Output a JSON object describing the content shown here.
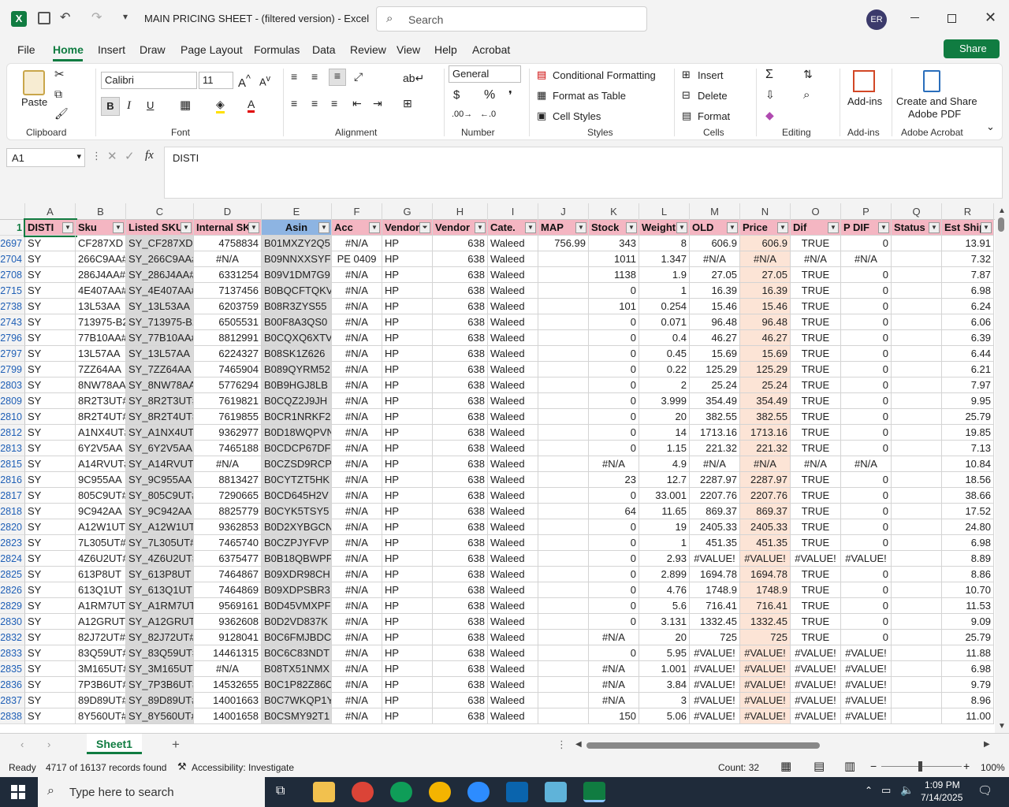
{
  "window": {
    "title": "MAIN PRICING SHEET - (filtered version)  -  Excel",
    "search_placeholder": "Search",
    "user_initials": "ER"
  },
  "menu": [
    "File",
    "Home",
    "Insert",
    "Draw",
    "Page Layout",
    "Formulas",
    "Data",
    "Review",
    "View",
    "Help",
    "Acrobat"
  ],
  "share_label": "Share",
  "ribbon": {
    "clipboard": {
      "paste": "Paste",
      "label": "Clipboard"
    },
    "font": {
      "name": "Calibri",
      "size": "11",
      "label": "Font"
    },
    "alignment": {
      "label": "Alignment"
    },
    "number": {
      "format": "General",
      "label": "Number"
    },
    "styles": {
      "cond": "Conditional Formatting",
      "table": "Format as Table",
      "cell": "Cell Styles",
      "label": "Styles"
    },
    "cells": {
      "insert": "Insert",
      "delete": "Delete",
      "format": "Format",
      "label": "Cells"
    },
    "editing": {
      "label": "Editing"
    },
    "addins": {
      "btn": "Add-ins",
      "label": "Add-ins"
    },
    "acrobat": {
      "btn1": "Create and Share",
      "btn2": "Adobe PDF",
      "label": "Adobe Acrobat"
    }
  },
  "formula": {
    "namebox": "A1",
    "content": "DISTI"
  },
  "columns": [
    "A",
    "B",
    "C",
    "D",
    "E",
    "F",
    "G",
    "H",
    "I",
    "J",
    "K",
    "L",
    "M",
    "N",
    "O",
    "P",
    "Q",
    "R"
  ],
  "headers": [
    "DISTI",
    "Sku",
    "Listed SKU",
    "Internal SK",
    "Asin",
    "Acc",
    "Vendor",
    "Vendor",
    "Cate.",
    "MAP",
    "Stock",
    "Weight",
    "OLD",
    "Price",
    "Dif",
    "P DIF",
    "Status",
    "Est Ship"
  ],
  "rows": [
    {
      "n": "2697",
      "v": [
        "SY",
        "CF287XD",
        "SY_CF287XD",
        "4758834",
        "B01MXZY2Q5",
        "#N/A",
        "HP",
        "638",
        "Waleed",
        "756.99",
        "343",
        "8",
        "606.9",
        "606.9",
        "TRUE",
        "0",
        "",
        "13.91"
      ]
    },
    {
      "n": "2704",
      "v": [
        "SY",
        "266C9AA#",
        "SY_266C9AA#",
        "#N/A",
        "B09NNXXSYF",
        "PE 0409",
        "HP",
        "638",
        "Waleed",
        "",
        "1011",
        "1.347",
        "#N/A",
        "#N/A",
        "#N/A",
        "#N/A",
        "",
        "7.32"
      ]
    },
    {
      "n": "2708",
      "v": [
        "SY",
        "286J4AA#",
        "SY_286J4AA#",
        "6331254",
        "B09V1DM7G9",
        "#N/A",
        "HP",
        "638",
        "Waleed",
        "",
        "1138",
        "1.9",
        "27.05",
        "27.05",
        "TRUE",
        "0",
        "",
        "7.87"
      ]
    },
    {
      "n": "2715",
      "v": [
        "SY",
        "4E407AA#",
        "SY_4E407AA#",
        "7137456",
        "B0BQCFTQKV",
        "#N/A",
        "HP",
        "638",
        "Waleed",
        "",
        "0",
        "1",
        "16.39",
        "16.39",
        "TRUE",
        "0",
        "",
        "6.98"
      ]
    },
    {
      "n": "2738",
      "v": [
        "SY",
        "13L53AA",
        "SY_13L53AA",
        "6203759",
        "B08R3ZYS55",
        "#N/A",
        "HP",
        "638",
        "Waleed",
        "",
        "101",
        "0.254",
        "15.46",
        "15.46",
        "TRUE",
        "0",
        "",
        "6.24"
      ]
    },
    {
      "n": "2743",
      "v": [
        "SY",
        "713975-B2",
        "SY_713975-B2",
        "6505531",
        "B00F8A3QS0",
        "#N/A",
        "HP",
        "638",
        "Waleed",
        "",
        "0",
        "0.071",
        "96.48",
        "96.48",
        "TRUE",
        "0",
        "",
        "6.06"
      ]
    },
    {
      "n": "2796",
      "v": [
        "SY",
        "77B10AA#",
        "SY_77B10AA#",
        "8812991",
        "B0CQXQ6XTV",
        "#N/A",
        "HP",
        "638",
        "Waleed",
        "",
        "0",
        "0.4",
        "46.27",
        "46.27",
        "TRUE",
        "0",
        "",
        "6.39"
      ]
    },
    {
      "n": "2797",
      "v": [
        "SY",
        "13L57AA",
        "SY_13L57AA",
        "6224327",
        "B08SK1Z626",
        "#N/A",
        "HP",
        "638",
        "Waleed",
        "",
        "0",
        "0.45",
        "15.69",
        "15.69",
        "TRUE",
        "0",
        "",
        "6.44"
      ]
    },
    {
      "n": "2799",
      "v": [
        "SY",
        "7ZZ64AA",
        "SY_7ZZ64AA",
        "7465904",
        "B089QYRM52",
        "#N/A",
        "HP",
        "638",
        "Waleed",
        "",
        "0",
        "0.22",
        "125.29",
        "125.29",
        "TRUE",
        "0",
        "",
        "6.21"
      ]
    },
    {
      "n": "2803",
      "v": [
        "SY",
        "8NW78AA",
        "SY_8NW78AA",
        "5776294",
        "B0B9HGJ8LB",
        "#N/A",
        "HP",
        "638",
        "Waleed",
        "",
        "0",
        "2",
        "25.24",
        "25.24",
        "TRUE",
        "0",
        "",
        "7.97"
      ]
    },
    {
      "n": "2809",
      "v": [
        "SY",
        "8R2T3UT#",
        "SY_8R2T3UT#",
        "7619821",
        "B0CQZ2J9JH",
        "#N/A",
        "HP",
        "638",
        "Waleed",
        "",
        "0",
        "3.999",
        "354.49",
        "354.49",
        "TRUE",
        "0",
        "",
        "9.95"
      ]
    },
    {
      "n": "2810",
      "v": [
        "SY",
        "8R2T4UT#",
        "SY_8R2T4UT#",
        "7619855",
        "B0CR1NRKF2",
        "#N/A",
        "HP",
        "638",
        "Waleed",
        "",
        "0",
        "20",
        "382.55",
        "382.55",
        "TRUE",
        "0",
        "",
        "25.79"
      ]
    },
    {
      "n": "2812",
      "v": [
        "SY",
        "A1NX4UT#",
        "SY_A1NX4UT#",
        "9362977",
        "B0D18WQPVN",
        "#N/A",
        "HP",
        "638",
        "Waleed",
        "",
        "0",
        "14",
        "1713.16",
        "1713.16",
        "TRUE",
        "0",
        "",
        "19.85"
      ]
    },
    {
      "n": "2813",
      "v": [
        "SY",
        "6Y2V5AA",
        "SY_6Y2V5AA",
        "7465188",
        "B0CDCP67DF",
        "#N/A",
        "HP",
        "638",
        "Waleed",
        "",
        "0",
        "1.15",
        "221.32",
        "221.32",
        "TRUE",
        "0",
        "",
        "7.13"
      ]
    },
    {
      "n": "2815",
      "v": [
        "SY",
        "A14RVUT#",
        "SY_A14RVUT#",
        "#N/A",
        "B0CZSD9RCP",
        "#N/A",
        "HP",
        "638",
        "Waleed",
        "",
        "#N/A",
        "4.9",
        "#N/A",
        "#N/A",
        "#N/A",
        "#N/A",
        "",
        "10.84"
      ]
    },
    {
      "n": "2816",
      "v": [
        "SY",
        "9C955AA",
        "SY_9C955AA",
        "8813427",
        "B0CYTZT5HK",
        "#N/A",
        "HP",
        "638",
        "Waleed",
        "",
        "23",
        "12.7",
        "2287.97",
        "2287.97",
        "TRUE",
        "0",
        "",
        "18.56"
      ]
    },
    {
      "n": "2817",
      "v": [
        "SY",
        "805C9UT#",
        "SY_805C9UT#",
        "7290665",
        "B0CD645H2V",
        "#N/A",
        "HP",
        "638",
        "Waleed",
        "",
        "0",
        "33.001",
        "2207.76",
        "2207.76",
        "TRUE",
        "0",
        "",
        "38.66"
      ]
    },
    {
      "n": "2818",
      "v": [
        "SY",
        "9C942AA",
        "SY_9C942AA",
        "8825779",
        "B0CYK5TSY5",
        "#N/A",
        "HP",
        "638",
        "Waleed",
        "",
        "64",
        "11.65",
        "869.37",
        "869.37",
        "TRUE",
        "0",
        "",
        "17.52"
      ]
    },
    {
      "n": "2820",
      "v": [
        "SY",
        "A12W1UT",
        "SY_A12W1UT#",
        "9362853",
        "B0D2XYBGCN",
        "#N/A",
        "HP",
        "638",
        "Waleed",
        "",
        "0",
        "19",
        "2405.33",
        "2405.33",
        "TRUE",
        "0",
        "",
        "24.80"
      ]
    },
    {
      "n": "2823",
      "v": [
        "SY",
        "7L305UT#",
        "SY_7L305UT#",
        "7465740",
        "B0CZPJYFVP",
        "#N/A",
        "HP",
        "638",
        "Waleed",
        "",
        "0",
        "1",
        "451.35",
        "451.35",
        "TRUE",
        "0",
        "",
        "6.98"
      ]
    },
    {
      "n": "2824",
      "v": [
        "SY",
        "4Z6U2UT#",
        "SY_4Z6U2UT#",
        "6375477",
        "B0B18QBWPF",
        "#N/A",
        "HP",
        "638",
        "Waleed",
        "",
        "0",
        "2.93",
        "#VALUE!",
        "#VALUE!",
        "#VALUE!",
        "#VALUE!",
        "",
        "8.89"
      ]
    },
    {
      "n": "2825",
      "v": [
        "SY",
        "613P8UT",
        "SY_613P8UT",
        "7464867",
        "B09XDR98CH",
        "#N/A",
        "HP",
        "638",
        "Waleed",
        "",
        "0",
        "2.899",
        "1694.78",
        "1694.78",
        "TRUE",
        "0",
        "",
        "8.86"
      ]
    },
    {
      "n": "2826",
      "v": [
        "SY",
        "613Q1UT",
        "SY_613Q1UT",
        "7464869",
        "B09XDPSBR3",
        "#N/A",
        "HP",
        "638",
        "Waleed",
        "",
        "0",
        "4.76",
        "1748.9",
        "1748.9",
        "TRUE",
        "0",
        "",
        "10.70"
      ]
    },
    {
      "n": "2829",
      "v": [
        "SY",
        "A1RM7UT",
        "SY_A1RM7UT#",
        "9569161",
        "B0D45VMXPF",
        "#N/A",
        "HP",
        "638",
        "Waleed",
        "",
        "0",
        "5.6",
        "716.41",
        "716.41",
        "TRUE",
        "0",
        "",
        "11.53"
      ]
    },
    {
      "n": "2830",
      "v": [
        "SY",
        "A12GRUT#",
        "SY_A12GRUT#",
        "9362608",
        "B0D2VD837K",
        "#N/A",
        "HP",
        "638",
        "Waleed",
        "",
        "0",
        "3.131",
        "1332.45",
        "1332.45",
        "TRUE",
        "0",
        "",
        "9.09"
      ]
    },
    {
      "n": "2832",
      "v": [
        "SY",
        "82J72UT#",
        "SY_82J72UT#",
        "9128041",
        "B0C6FMJBDC",
        "#N/A",
        "HP",
        "638",
        "Waleed",
        "",
        "#N/A",
        "20",
        "725",
        "725",
        "TRUE",
        "0",
        "",
        "25.79"
      ]
    },
    {
      "n": "2833",
      "v": [
        "SY",
        "83Q59UT#",
        "SY_83Q59UT#",
        "14461315",
        "B0C6C83NDT",
        "#N/A",
        "HP",
        "638",
        "Waleed",
        "",
        "0",
        "5.95",
        "#VALUE!",
        "#VALUE!",
        "#VALUE!",
        "#VALUE!",
        "",
        "11.88"
      ]
    },
    {
      "n": "2835",
      "v": [
        "SY",
        "3M165UT#",
        "SY_3M165UT#",
        "#N/A",
        "B08TX51NMX",
        "#N/A",
        "HP",
        "638",
        "Waleed",
        "",
        "#N/A",
        "1.001",
        "#VALUE!",
        "#VALUE!",
        "#VALUE!",
        "#VALUE!",
        "",
        "6.98"
      ]
    },
    {
      "n": "2836",
      "v": [
        "SY",
        "7P3B6UT#",
        "SY_7P3B6UT#",
        "14532655",
        "B0C1P82Z86C",
        "#N/A",
        "HP",
        "638",
        "Waleed",
        "",
        "#N/A",
        "3.84",
        "#VALUE!",
        "#VALUE!",
        "#VALUE!",
        "#VALUE!",
        "",
        "9.79"
      ]
    },
    {
      "n": "2837",
      "v": [
        "SY",
        "89D89UT#",
        "SY_89D89UT#",
        "14001663",
        "B0C7WKQP1Y",
        "#N/A",
        "HP",
        "638",
        "Waleed",
        "",
        "#N/A",
        "3",
        "#VALUE!",
        "#VALUE!",
        "#VALUE!",
        "#VALUE!",
        "",
        "8.96"
      ]
    },
    {
      "n": "2838",
      "v": [
        "SY",
        "8Y560UT#",
        "SY_8Y560UT#",
        "14001658",
        "B0CSMY92T1",
        "#N/A",
        "HP",
        "638",
        "Waleed",
        "",
        "150",
        "5.06",
        "#VALUE!",
        "#VALUE!",
        "#VALUE!",
        "#VALUE!",
        "",
        "11.00"
      ]
    }
  ],
  "sheet_tab": "Sheet1",
  "status": {
    "ready": "Ready",
    "records": "4717 of 16137 records found",
    "accessibility": "Accessibility: Investigate",
    "count": "Count: 32",
    "zoom": "100%"
  },
  "taskbar": {
    "search_placeholder": "Type here to search",
    "time": "1:09 PM",
    "date": "7/14/2025"
  },
  "colors": {
    "excel_green": "#107c41",
    "header_pink": "#f4b6c2",
    "asin_blue": "#8db4e2",
    "price_peach": "#fce4d6"
  }
}
